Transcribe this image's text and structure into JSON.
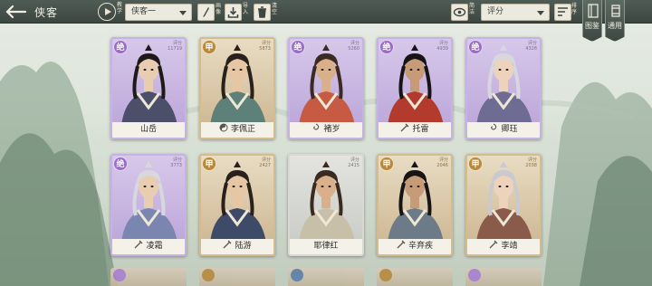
{
  "header": {
    "title": "侠客",
    "play_label": "教学",
    "filter_select": "侠客一",
    "draw_label": "画像",
    "import_label": "导入",
    "clear_label": "清空",
    "view_label": "简洁",
    "sort_select": "评分",
    "sort_label": "排序",
    "atlas_label": "图鉴",
    "general_label": "通用"
  },
  "cards": [
    {
      "name": "山岳",
      "rarity": "purple",
      "rank": "绝",
      "score_label": "评分",
      "score": "11719",
      "sect_icon": "none"
    },
    {
      "name": "李佩正",
      "rarity": "gold",
      "rank": "甲",
      "score_label": "评分",
      "score": "5873",
      "sect_icon": "yin-yang-icon"
    },
    {
      "name": "褚岁",
      "rarity": "purple",
      "rank": "绝",
      "score_label": "评分",
      "score": "5260",
      "sect_icon": "swirl-icon"
    },
    {
      "name": "托雷",
      "rarity": "purple",
      "rank": "绝",
      "score_label": "评分",
      "score": "4939",
      "sect_icon": "sword-icon"
    },
    {
      "name": "卿珏",
      "rarity": "purple",
      "rank": "绝",
      "score_label": "评分",
      "score": "4328",
      "sect_icon": "swirl-icon"
    },
    {
      "name": "凌霜",
      "rarity": "purple",
      "rank": "绝",
      "score_label": "评分",
      "score": "3773",
      "sect_icon": "sword-icon"
    },
    {
      "name": "陆游",
      "rarity": "gold",
      "rank": "甲",
      "score_label": "评分",
      "score": "2427",
      "sect_icon": "sword-icon"
    },
    {
      "name": "耶律红",
      "rarity": "grey",
      "rank": "",
      "score_label": "评分",
      "score": "2415",
      "sect_icon": "none"
    },
    {
      "name": "辛弃疾",
      "rarity": "gold",
      "rank": "甲",
      "score_label": "评分",
      "score": "2046",
      "sect_icon": "sword-icon"
    },
    {
      "name": "李靖",
      "rarity": "gold",
      "rank": "甲",
      "score_label": "评分",
      "score": "2038",
      "sect_icon": "sword-icon"
    }
  ],
  "colors": {
    "accent_purple": "#b9a3d8",
    "accent_gold": "#cbb48e",
    "topbar": "#3c4641"
  }
}
